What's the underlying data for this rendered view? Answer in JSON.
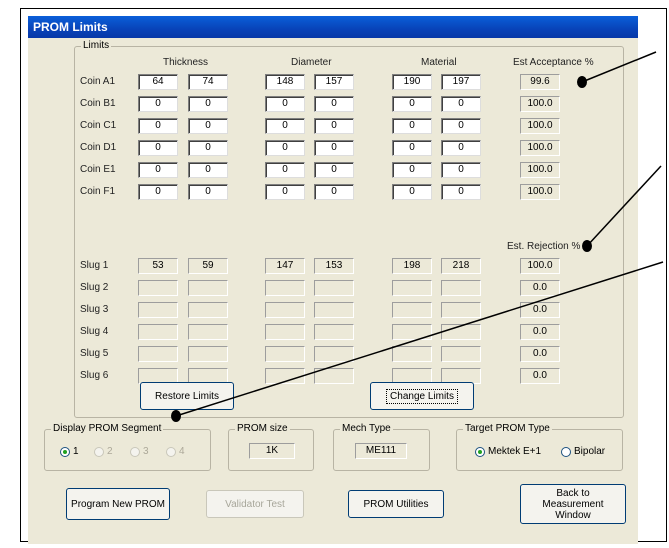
{
  "window": {
    "title": "PROM Limits"
  },
  "limits_group": {
    "title": "Limits"
  },
  "column_headers": {
    "thickness": "Thickness",
    "diameter": "Diameter",
    "material": "Material",
    "est_acceptance": "Est Acceptance %",
    "est_rejection": "Est. Rejection %"
  },
  "coins": [
    {
      "name": "Coin A1",
      "thickness": [
        "64",
        "74"
      ],
      "diameter": [
        "148",
        "157"
      ],
      "material": [
        "190",
        "197"
      ],
      "acceptance": "99.6"
    },
    {
      "name": "Coin B1",
      "thickness": [
        "0",
        "0"
      ],
      "diameter": [
        "0",
        "0"
      ],
      "material": [
        "0",
        "0"
      ],
      "acceptance": "100.0"
    },
    {
      "name": "Coin C1",
      "thickness": [
        "0",
        "0"
      ],
      "diameter": [
        "0",
        "0"
      ],
      "material": [
        "0",
        "0"
      ],
      "acceptance": "100.0"
    },
    {
      "name": "Coin D1",
      "thickness": [
        "0",
        "0"
      ],
      "diameter": [
        "0",
        "0"
      ],
      "material": [
        "0",
        "0"
      ],
      "acceptance": "100.0"
    },
    {
      "name": "Coin E1",
      "thickness": [
        "0",
        "0"
      ],
      "diameter": [
        "0",
        "0"
      ],
      "material": [
        "0",
        "0"
      ],
      "acceptance": "100.0"
    },
    {
      "name": "Coin F1",
      "thickness": [
        "0",
        "0"
      ],
      "diameter": [
        "0",
        "0"
      ],
      "material": [
        "0",
        "0"
      ],
      "acceptance": "100.0"
    }
  ],
  "slugs": [
    {
      "name": "Slug 1",
      "thickness": [
        "53",
        "59"
      ],
      "diameter": [
        "147",
        "153"
      ],
      "material": [
        "198",
        "218"
      ],
      "rejection": "100.0"
    },
    {
      "name": "Slug 2",
      "thickness": [
        "",
        ""
      ],
      "diameter": [
        "",
        ""
      ],
      "material": [
        "",
        ""
      ],
      "rejection": "0.0"
    },
    {
      "name": "Slug 3",
      "thickness": [
        "",
        ""
      ],
      "diameter": [
        "",
        ""
      ],
      "material": [
        "",
        ""
      ],
      "rejection": "0.0"
    },
    {
      "name": "Slug 4",
      "thickness": [
        "",
        ""
      ],
      "diameter": [
        "",
        ""
      ],
      "material": [
        "",
        ""
      ],
      "rejection": "0.0"
    },
    {
      "name": "Slug 5",
      "thickness": [
        "",
        ""
      ],
      "diameter": [
        "",
        ""
      ],
      "material": [
        "",
        ""
      ],
      "rejection": "0.0"
    },
    {
      "name": "Slug 6",
      "thickness": [
        "",
        ""
      ],
      "diameter": [
        "",
        ""
      ],
      "material": [
        "",
        ""
      ],
      "rejection": "0.0"
    }
  ],
  "buttons": {
    "restore_limits": "Restore Limits",
    "change_limits": "Change Limits",
    "program_new_prom": "Program New PROM",
    "validator_test": "Validator Test",
    "prom_utilities": "PROM Utilities",
    "back_to_measurement": "Back to Measurement Window"
  },
  "display_prom_segment": {
    "title": "Display PROM Segment",
    "options": [
      "1",
      "2",
      "3",
      "4"
    ],
    "selected": "1"
  },
  "prom_size": {
    "title": "PROM size",
    "value": "1K"
  },
  "mech_type": {
    "title": "Mech Type",
    "value": "ME111"
  },
  "target_prom_type": {
    "title": "Target PROM Type",
    "options": [
      "Mektek E+1",
      "Bipolar"
    ],
    "selected": "Mektek E+1"
  },
  "colors": {
    "titlebar": "#0a5fd9",
    "dialog_bg": "#ece9d8",
    "radio_selected": "#21a121"
  }
}
